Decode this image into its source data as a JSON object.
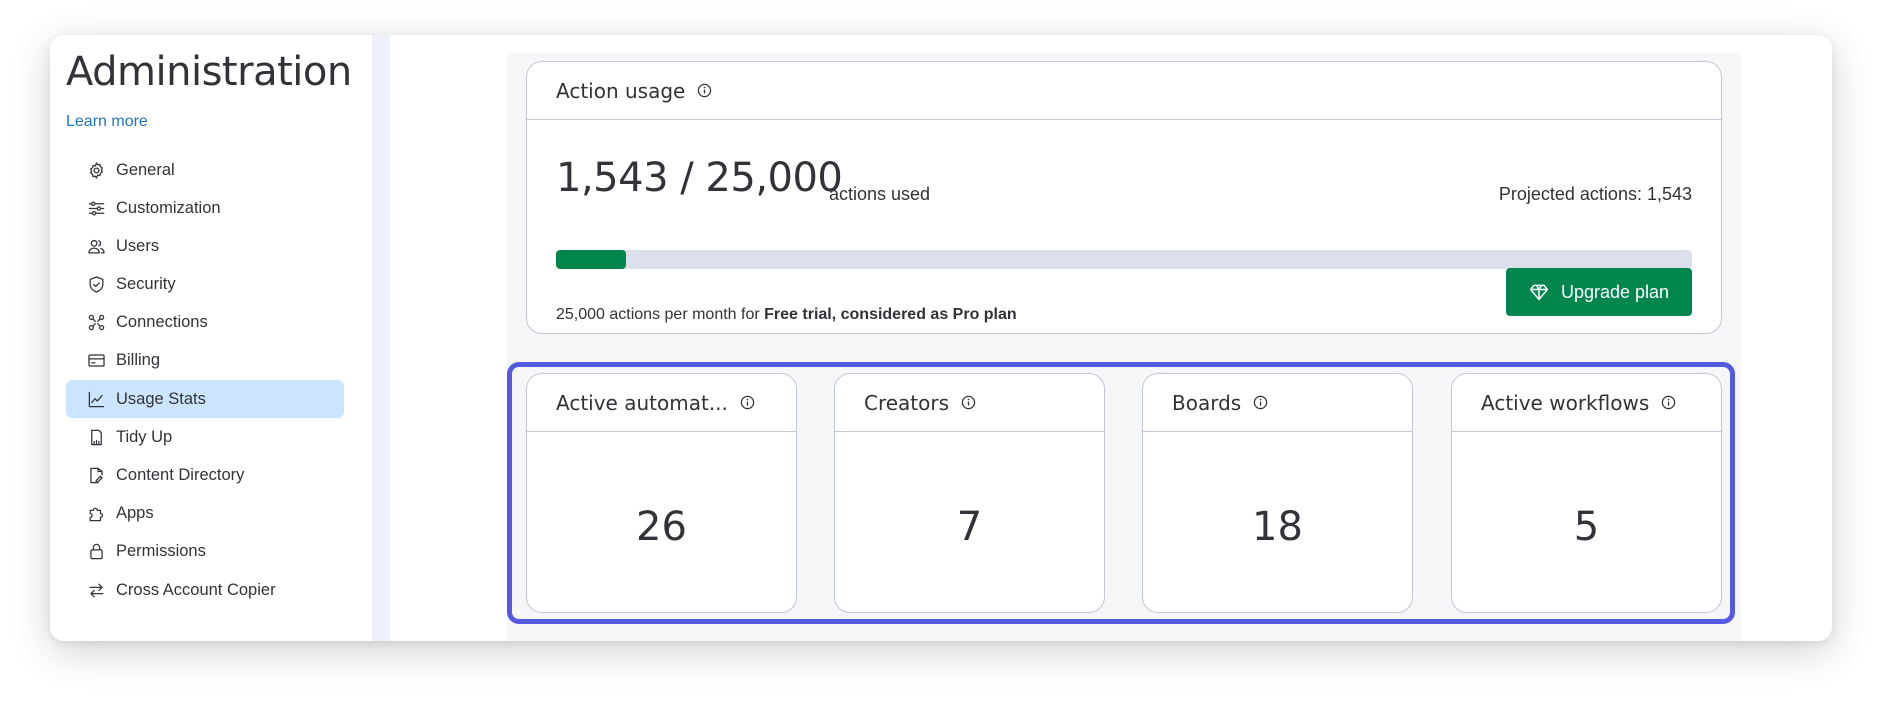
{
  "sidebar": {
    "title": "Administration",
    "learn_more": "Learn more",
    "items": [
      {
        "label": "General",
        "icon": "gear-icon"
      },
      {
        "label": "Customization",
        "icon": "sliders-icon"
      },
      {
        "label": "Users",
        "icon": "users-icon"
      },
      {
        "label": "Security",
        "icon": "shield-icon"
      },
      {
        "label": "Connections",
        "icon": "connections-icon"
      },
      {
        "label": "Billing",
        "icon": "credit-card-icon"
      },
      {
        "label": "Usage Stats",
        "icon": "line-chart-icon",
        "active": true
      },
      {
        "label": "Tidy Up",
        "icon": "broom-icon"
      },
      {
        "label": "Content Directory",
        "icon": "document-edit-icon"
      },
      {
        "label": "Apps",
        "icon": "puzzle-icon"
      },
      {
        "label": "Permissions",
        "icon": "lock-icon"
      },
      {
        "label": "Cross Account Copier",
        "icon": "transfer-arrows-icon"
      }
    ]
  },
  "usage": {
    "title": "Action usage",
    "used_display": "1,543 / 25,000",
    "unit": "actions used",
    "projected": "Projected actions: 1,543",
    "progress_fraction": 0.062,
    "plan_prefix": "25,000 actions per month for",
    "plan_name": "Free trial, considered as Pro plan",
    "upgrade_label": "Upgrade plan"
  },
  "stats": [
    {
      "label": "Active automat...",
      "value": "26"
    },
    {
      "label": "Creators",
      "value": "7"
    },
    {
      "label": "Boards",
      "value": "18"
    },
    {
      "label": "Active workflows",
      "value": "5"
    }
  ],
  "colors": {
    "accent_green": "#00854d",
    "link_blue": "#1f76c2",
    "active_nav": "#cce5ff",
    "highlight": "#5559df"
  }
}
